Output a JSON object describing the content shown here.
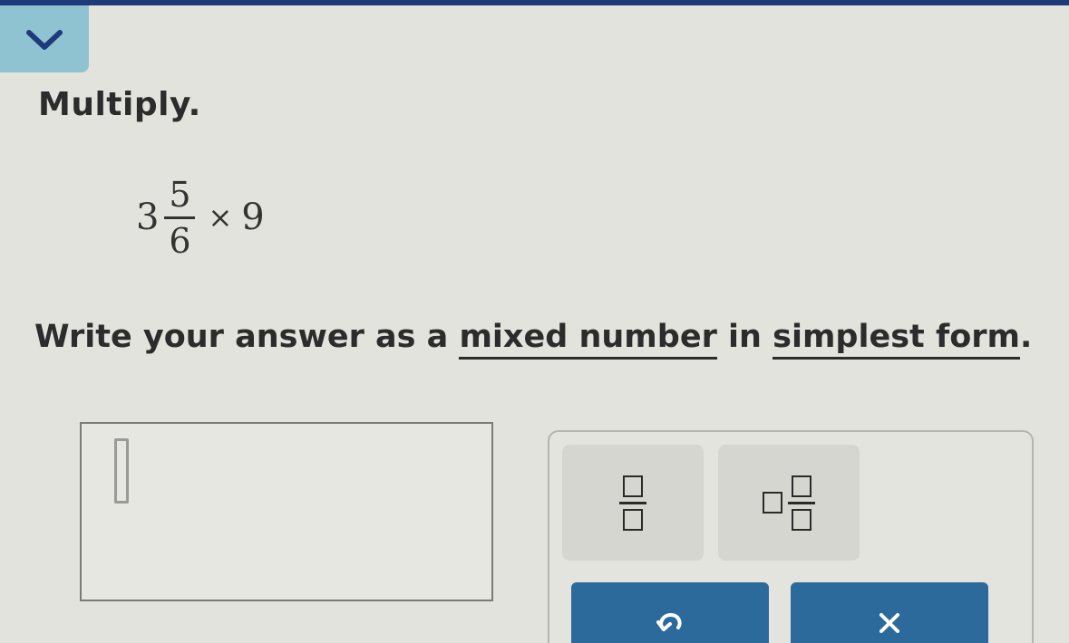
{
  "header": {
    "collapse_icon": "chevron-down-icon",
    "accent_color": "#1f3a7a",
    "tab_color": "#8fc3d2"
  },
  "problem": {
    "instruction": "Multiply.",
    "whole": "3",
    "numerator": "5",
    "denominator": "6",
    "operator": "×",
    "factor": "9"
  },
  "directions": {
    "prefix": "Write your answer as a ",
    "term1": "mixed number",
    "middle": " in ",
    "term2": "simplest form",
    "suffix": "."
  },
  "answer": {
    "value": ""
  },
  "keypad": {
    "keys": [
      {
        "name": "fraction-template",
        "icon": "fraction-template-icon"
      },
      {
        "name": "mixed-number-template",
        "icon": "mixed-number-template-icon"
      }
    ],
    "buttons": [
      {
        "name": "undo",
        "icon": "undo-icon"
      },
      {
        "name": "clear",
        "icon": "x-icon"
      }
    ],
    "button_color": "#2c6a9c"
  }
}
